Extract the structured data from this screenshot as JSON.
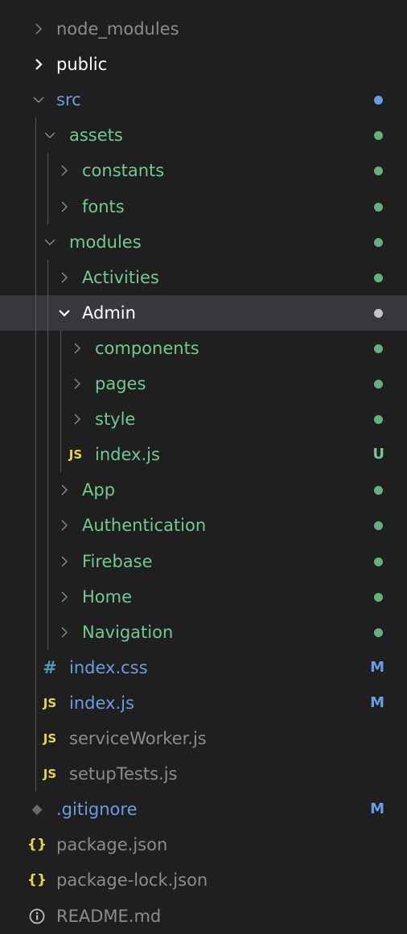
{
  "colors": {
    "background": "#1f1f1f",
    "selected_row": "#37373d",
    "untracked_green": "#73c991",
    "modified_blue": "#6c9ce1",
    "ignored_gray": "#8c8c8c",
    "default_text": "#cccccc",
    "js_icon": "#e8d44d",
    "css_icon": "#519aba"
  },
  "tree": [
    {
      "label": "node_modules",
      "kind": "folder",
      "expanded": false,
      "indent": 0,
      "status": "ignored"
    },
    {
      "label": "public",
      "kind": "folder",
      "expanded": false,
      "indent": 0,
      "status": "normal"
    },
    {
      "label": "src",
      "kind": "folder",
      "expanded": true,
      "indent": 0,
      "status": "blue",
      "decoration": "dot-blue"
    },
    {
      "label": "assets",
      "kind": "folder",
      "expanded": true,
      "indent": 1,
      "status": "green",
      "decoration": "dot-green"
    },
    {
      "label": "constants",
      "kind": "folder",
      "expanded": false,
      "indent": 2,
      "status": "green",
      "decoration": "dot-green"
    },
    {
      "label": "fonts",
      "kind": "folder",
      "expanded": false,
      "indent": 2,
      "status": "green",
      "decoration": "dot-green"
    },
    {
      "label": "modules",
      "kind": "folder",
      "expanded": true,
      "indent": 1,
      "status": "green",
      "decoration": "dot-green"
    },
    {
      "label": "Activities",
      "kind": "folder",
      "expanded": false,
      "indent": 2,
      "status": "green",
      "decoration": "dot-green"
    },
    {
      "label": "Admin",
      "kind": "folder",
      "expanded": true,
      "indent": 2,
      "status": "selected",
      "decoration": "dot-white",
      "selected": true
    },
    {
      "label": "components",
      "kind": "folder",
      "expanded": false,
      "indent": 3,
      "status": "green",
      "decoration": "dot-green"
    },
    {
      "label": "pages",
      "kind": "folder",
      "expanded": false,
      "indent": 3,
      "status": "green",
      "decoration": "dot-green"
    },
    {
      "label": "style",
      "kind": "folder",
      "expanded": false,
      "indent": 3,
      "status": "green",
      "decoration": "dot-green"
    },
    {
      "label": "index.js",
      "kind": "file",
      "icon": "js-icon",
      "icon_text": "JS",
      "indent": 3,
      "status": "green",
      "decoration": "badge",
      "badge": "U"
    },
    {
      "label": "App",
      "kind": "folder",
      "expanded": false,
      "indent": 2,
      "status": "green",
      "decoration": "dot-green"
    },
    {
      "label": "Authentication",
      "kind": "folder",
      "expanded": false,
      "indent": 2,
      "status": "green",
      "decoration": "dot-green"
    },
    {
      "label": "Firebase",
      "kind": "folder",
      "expanded": false,
      "indent": 2,
      "status": "green",
      "decoration": "dot-green"
    },
    {
      "label": "Home",
      "kind": "folder",
      "expanded": false,
      "indent": 2,
      "status": "green",
      "decoration": "dot-green"
    },
    {
      "label": "Navigation",
      "kind": "folder",
      "expanded": false,
      "indent": 2,
      "status": "green",
      "decoration": "dot-green"
    },
    {
      "label": "index.css",
      "kind": "file",
      "icon": "css-icon",
      "icon_text": "#",
      "indent": 1,
      "status": "blue",
      "decoration": "badge",
      "badge": "M"
    },
    {
      "label": "index.js",
      "kind": "file",
      "icon": "js-icon",
      "icon_text": "JS",
      "indent": 1,
      "status": "blue",
      "decoration": "badge",
      "badge": "M"
    },
    {
      "label": "serviceWorker.js",
      "kind": "file",
      "icon": "js-icon",
      "icon_text": "JS",
      "indent": 1,
      "status": "ignored"
    },
    {
      "label": "setupTests.js",
      "kind": "file",
      "icon": "js-icon",
      "icon_text": "JS",
      "indent": 1,
      "status": "ignored"
    },
    {
      "label": ".gitignore",
      "kind": "file",
      "icon": "git-icon",
      "icon_text": "◆",
      "indent": 0,
      "status": "blue",
      "decoration": "badge",
      "badge": "M"
    },
    {
      "label": "package.json",
      "kind": "file",
      "icon": "json-icon",
      "icon_text": "{}",
      "indent": 0,
      "status": "ignored"
    },
    {
      "label": "package-lock.json",
      "kind": "file",
      "icon": "json-icon",
      "icon_text": "{}",
      "indent": 0,
      "status": "ignored"
    },
    {
      "label": "README.md",
      "kind": "file",
      "icon": "info-icon",
      "icon_text": "i",
      "indent": 0,
      "status": "ignored"
    }
  ]
}
